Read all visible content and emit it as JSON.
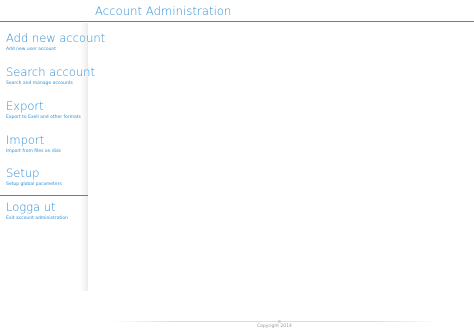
{
  "header": {
    "title": "Account Administration"
  },
  "sidebar": {
    "items": [
      {
        "label": "Add new account",
        "description": "Add new user account"
      },
      {
        "label": "Search account",
        "description": "Search and manage accounts"
      },
      {
        "label": "Export",
        "description": "Export to Exell and other formats"
      },
      {
        "label": "Import",
        "description": "Import from files on disk"
      },
      {
        "label": "Setup",
        "description": "Setup global parameters"
      },
      {
        "label": "Logga ut",
        "description": "Exit account administration"
      }
    ]
  },
  "footer": {
    "copyright": "Copyright 2014"
  },
  "colors": {
    "accent": "#2f8fd6",
    "muted": "#999999"
  }
}
